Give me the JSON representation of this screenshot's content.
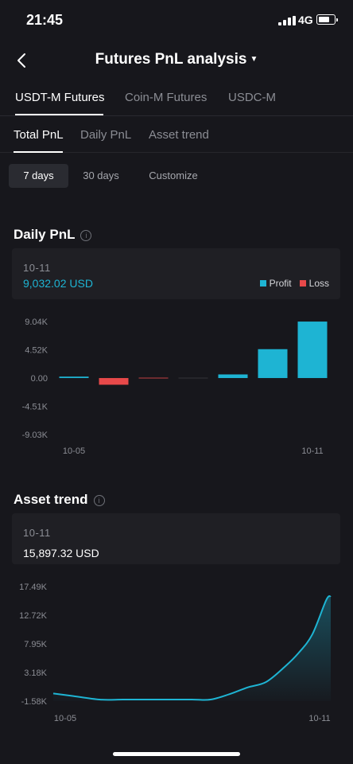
{
  "status_bar": {
    "time": "21:45",
    "network": "4G"
  },
  "header": {
    "title": "Futures PnL analysis"
  },
  "futures_tabs": [
    "USDT-M Futures",
    "Coin-M Futures",
    "USDC-M"
  ],
  "sub_tabs": [
    "Total PnL",
    "Daily PnL",
    "Asset trend"
  ],
  "range_options": [
    "7 days",
    "30 days",
    "Customize"
  ],
  "daily_pnl": {
    "title": "Daily PnL",
    "date": "10-11",
    "value": "9,032.02 USD",
    "legend": {
      "profit": "Profit",
      "loss": "Loss"
    }
  },
  "asset_trend": {
    "title": "Asset trend",
    "date": "10-11",
    "value": "15,897.32 USD"
  },
  "colors": {
    "profit": "#1eb4d3",
    "loss": "#e8494a",
    "background": "#17171c",
    "card": "#1f1f24"
  },
  "chart_data": [
    {
      "type": "bar",
      "x_tick_labels": [
        "10-05",
        "10-11"
      ],
      "categories": [
        "10-05",
        "10-06",
        "10-07",
        "10-08",
        "10-09",
        "10-10",
        "10-11"
      ],
      "values": [
        230,
        -1070,
        -60,
        0,
        580,
        4620,
        9032.02
      ],
      "y_tick_labels": [
        "9.04K",
        "4.52K",
        "0.00",
        "-4.51K",
        "-9.03K"
      ],
      "ylim": [
        -9030,
        9040
      ],
      "legend": [
        "Profit",
        "Loss"
      ]
    },
    {
      "type": "area",
      "x_tick_labels": [
        "10-05",
        "10-11"
      ],
      "x": [
        0,
        0.4,
        1,
        1.5,
        2,
        2.5,
        3,
        3.4,
        3.8,
        4.2,
        4.6,
        5,
        5.3,
        5.6,
        5.9,
        6
      ],
      "values": [
        -300,
        -700,
        -1320,
        -1320,
        -1320,
        -1320,
        -1320,
        -1320,
        -450,
        700,
        1600,
        4100,
        6400,
        9500,
        15200,
        15897.32
      ],
      "y_tick_labels": [
        "17.49K",
        "12.72K",
        "7.95K",
        "3.18K",
        "-1.58K"
      ],
      "ylim": [
        -1580,
        17490
      ]
    }
  ]
}
